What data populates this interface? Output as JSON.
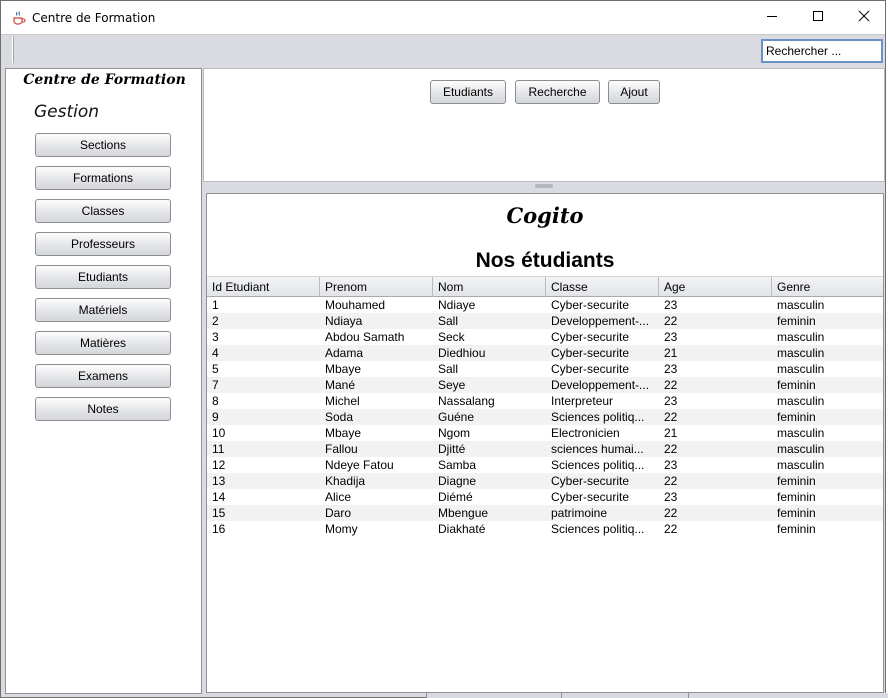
{
  "window": {
    "title": "Centre de Formation",
    "app_icon": "java-cup-icon",
    "controls": [
      "minimize-icon",
      "maximize-icon",
      "close-icon"
    ]
  },
  "toolbar": {
    "search_value": "Rechercher ..."
  },
  "sidebar": {
    "title": "Centre de Formation",
    "subtitle": "Gestion",
    "items": [
      {
        "label": "Sections"
      },
      {
        "label": "Formations"
      },
      {
        "label": "Classes"
      },
      {
        "label": "Professeurs"
      },
      {
        "label": "Etudiants"
      },
      {
        "label": "Matériels"
      },
      {
        "label": "Matières"
      },
      {
        "label": "Examens"
      },
      {
        "label": "Notes"
      }
    ]
  },
  "top_panel": {
    "buttons": [
      {
        "label": "Etudiants"
      },
      {
        "label": "Recherche"
      },
      {
        "label": "Ajout"
      }
    ]
  },
  "main": {
    "brand": "Cogito",
    "heading": "Nos étudiants",
    "table": {
      "columns": [
        "Id Etudiant",
        "Prenom",
        "Nom",
        "Classe",
        "Age",
        "Genre"
      ],
      "rows": [
        [
          "1",
          "Mouhamed",
          "Ndiaye",
          "Cyber-securite",
          "23",
          "masculin"
        ],
        [
          "2",
          "Ndiaya",
          "Sall",
          "Developpement-...",
          "22",
          "feminin"
        ],
        [
          "3",
          "Abdou Samath",
          "Seck",
          "Cyber-securite",
          "23",
          "masculin"
        ],
        [
          "4",
          "Adama",
          "Diedhiou",
          "Cyber-securite",
          "21",
          "masculin"
        ],
        [
          "5",
          "Mbaye",
          "Sall",
          "Cyber-securite",
          "23",
          "masculin"
        ],
        [
          "7",
          "Mané",
          "Seye",
          "Developpement-...",
          "22",
          "feminin"
        ],
        [
          "8",
          "Michel",
          "Nassalang",
          "Interpreteur",
          "23",
          "masculin"
        ],
        [
          "9",
          "Soda",
          "Guéne",
          "Sciences politiq...",
          "22",
          "feminin"
        ],
        [
          "10",
          "Mbaye",
          "Ngom",
          "Electronicien",
          "21",
          "masculin"
        ],
        [
          "11",
          "Fallou",
          "Djitté",
          "sciences humai...",
          "22",
          "masculin"
        ],
        [
          "12",
          "Ndeye Fatou",
          "Samba",
          "Sciences politiq...",
          "23",
          "masculin"
        ],
        [
          "13",
          "Khadija",
          "Diagne",
          "Cyber-securite",
          "22",
          "feminin"
        ],
        [
          "14",
          "Alice",
          "Diémé",
          "Cyber-securite",
          "23",
          "feminin"
        ],
        [
          "15",
          "Daro",
          "Mbengue",
          "patrimoine",
          "22",
          "feminin"
        ],
        [
          "16",
          "Momy",
          "Diakhaté",
          "Sciences politiq...",
          "22",
          "feminin"
        ]
      ]
    }
  }
}
